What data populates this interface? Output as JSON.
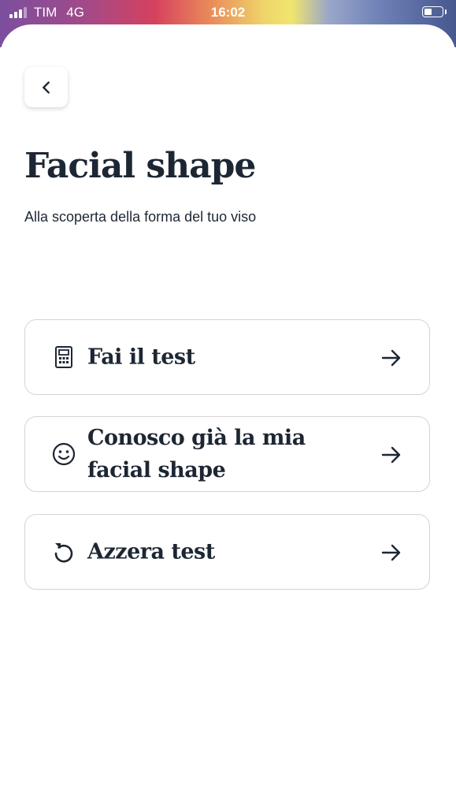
{
  "status_bar": {
    "carrier": "TIM",
    "network": "4G",
    "time": "16:02"
  },
  "header": {
    "back_icon": "chevron-left-icon",
    "title": "Facial shape",
    "subtitle": "Alla scoperta della forma del tuo viso"
  },
  "options": [
    {
      "label": "Fai il test",
      "icon": "calculator-icon",
      "arrow_icon": "arrow-right-icon"
    },
    {
      "label": "Conosco già la mia facial shape",
      "icon": "smiley-icon",
      "arrow_icon": "arrow-right-icon"
    },
    {
      "label": "Azzera test",
      "icon": "reset-icon",
      "arrow_icon": "arrow-right-icon"
    }
  ],
  "colors": {
    "text": "#1d2733",
    "card_border": "#d4d4d4",
    "background": "#ffffff"
  }
}
